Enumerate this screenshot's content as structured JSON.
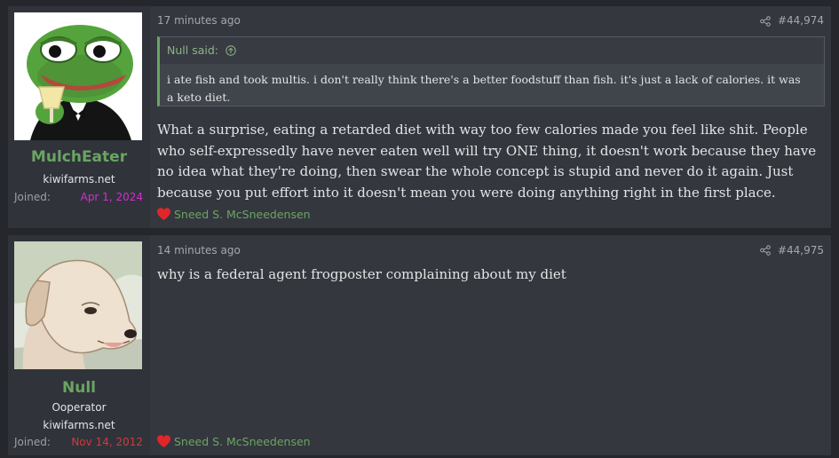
{
  "posts": [
    {
      "username": "MulchEater",
      "site": "kiwifarms.net",
      "joined_label": "Joined:",
      "joined_date": "Apr 1, 2024",
      "joined_color": "#d22ed2",
      "avatar": "pepe-frog-avatar",
      "timestamp": "17 minutes ago",
      "post_number": "#44,974",
      "quote": {
        "author": "Null said:",
        "text": "i ate fish and took multis. i don't really think there's a better foodstuff than fish. it's just a lack of calories. it was a keto diet."
      },
      "message": "What a surprise, eating a retarded diet with way too few calories made you feel like shit. People who self-expressedly have never eaten well will try ONE thing, it doesn't work because they have no idea what they're doing, then swear the whole concept is stupid and never do it again. Just because you put effort into it doesn't mean you were doing anything right in the first place.",
      "reaction": "Sneed S. McSneedensen"
    },
    {
      "username": "Null",
      "user_title": "Ooperator",
      "site": "kiwifarms.net",
      "joined_label": "Joined:",
      "joined_date": "Nov 14, 2012",
      "joined_color": "#d23a3a",
      "avatar": "dog-avatar",
      "timestamp": "14 minutes ago",
      "post_number": "#44,975",
      "message": "why is a federal agent frogposter complaining about my diet",
      "reaction": "Sneed S. McSneedensen"
    }
  ],
  "colors": {
    "page_bg": "#25272c",
    "post_bg": "#34373e",
    "username": "#6aa563",
    "reaction_heart": "#e0262a"
  }
}
